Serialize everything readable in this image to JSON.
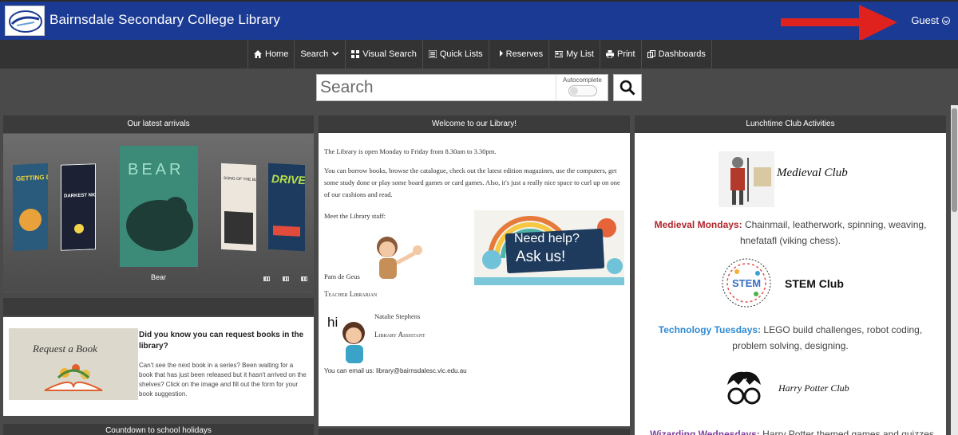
{
  "header": {
    "title": "Bairnsdale Secondary College Library",
    "user_label": "Guest",
    "accent_color": "#1b3a93"
  },
  "nav": [
    {
      "label": "Home",
      "icon": "home-icon"
    },
    {
      "label": "Search",
      "icon": "chevron-down-icon"
    },
    {
      "label": "Visual Search",
      "icon": "grid-icon"
    },
    {
      "label": "Quick Lists",
      "icon": "list-icon"
    },
    {
      "label": "Reserves",
      "icon": "share-icon"
    },
    {
      "label": "My List",
      "icon": "card-icon"
    },
    {
      "label": "Print",
      "icon": "print-icon"
    },
    {
      "label": "Dashboards",
      "icon": "dashboard-icon"
    }
  ],
  "search": {
    "placeholder": "Search",
    "autocomplete_label": "Autocomplete",
    "autocomplete_on": false
  },
  "latest": {
    "heading": "Our latest arrivals",
    "caption": "Bear",
    "books": [
      {
        "title": "GETTING DIZZY",
        "color": "#2a5a7c"
      },
      {
        "title": "DARKEST NIGHT BRIGHTEST STAR",
        "color": "#1c2233"
      },
      {
        "title": "BEAR",
        "color": "#2f6d62"
      },
      {
        "title": "SONG OF THE BLACKBIRD",
        "color": "#e8e2d8"
      },
      {
        "title": "DRIVE",
        "color": "#1d3b5e"
      }
    ]
  },
  "request": {
    "image_text": "Request a Book",
    "title": "Did you know you can request books in the library?",
    "body": "Can't see the next book in a series? Been waiting for a book that has just been released but it hasn't arrived on the shelves? Click on the image and fill out the form for your book suggestion."
  },
  "countdown_heading": "Countdown to school holidays",
  "welcome": {
    "heading": "Welcome to our Library!",
    "para1": "The Library is open Monday to Friday from 8.30am to 3.30pm.",
    "para2": "You can borrow books, browse the catalogue, check out the latest edition magazines, use the computers, get some study done or play some board games or card games. Also, it's just a really nice space to curl up on one of our cushions and read.",
    "meet": "Meet the Library staff:",
    "staff1_name": "Pam de Geus",
    "staff1_role": "Teacher Librarian",
    "hi": "hi",
    "staff2_name": "Natalie Stephens",
    "staff2_role": "Library Assistant",
    "email_line": "You can email us: library@bairnsdalesc.vic.edu.au",
    "help_line1": "Need help?",
    "help_line2": "Ask us!"
  },
  "clubs": {
    "heading": "Lunchtime Club Activities",
    "medieval_title": "Medieval Club",
    "medieval_day": "Medieval Mondays:",
    "medieval_desc": "Chainmail, leatherwork, spinning, weaving, hnefatafl (viking chess).",
    "stem_logo": "STEM",
    "stem_title": "STEM Club",
    "tech_day": "Technology Tuesdays:",
    "tech_desc": "LEGO build challenges, robot coding, problem solving, designing.",
    "hp_title": "Harry Potter Club",
    "wiz_day": "Wizarding Wednesdays:",
    "wiz_desc": "Harry Potter themed games and quizzes"
  }
}
